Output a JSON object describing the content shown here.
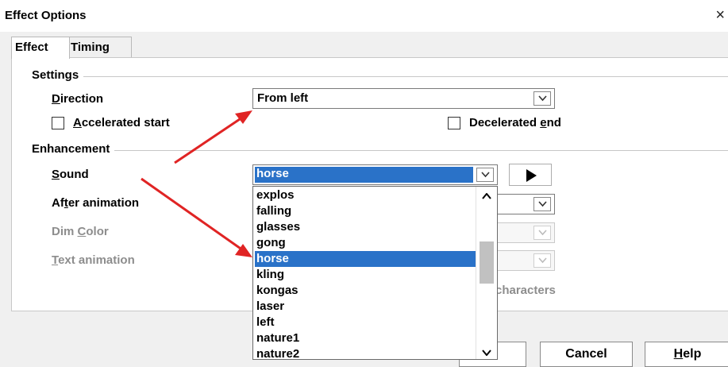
{
  "window": {
    "title": "Effect Options",
    "close_glyph": "×"
  },
  "tabs": [
    {
      "label": "Effect",
      "active": true
    },
    {
      "label": "Timing",
      "active": false
    }
  ],
  "settings": {
    "header": "Settings",
    "direction_label_first": "D",
    "direction_label_rest": "irection",
    "direction_value": "From left",
    "accelerated_label_first": "A",
    "accelerated_label_rest": "ccelerated start",
    "accelerated_checked": false,
    "decelerated_label_pre": "Decelerated ",
    "decelerated_label_u": "e",
    "decelerated_label_post": "nd",
    "decelerated_checked": false
  },
  "enhancement": {
    "header": "Enhancement",
    "sound_label_first": "S",
    "sound_label_rest": "ound",
    "sound_value": "horse",
    "after_animation_label_pre": "Af",
    "after_animation_label_u": "t",
    "after_animation_label_post": "er animation",
    "dim_color_label_pre": "Dim ",
    "dim_color_label_u": "C",
    "dim_color_label_post": "olor",
    "text_animation_label_first": "T",
    "text_animation_label_rest": "ext animation",
    "characters_label": "characters"
  },
  "sound_list": {
    "items": [
      "explos",
      "falling",
      "glasses",
      "gong",
      "horse",
      "kling",
      "kongas",
      "laser",
      "left",
      "nature1",
      "nature2"
    ],
    "selected_index": 4
  },
  "buttons": {
    "cancel": "Cancel",
    "help_first": "H",
    "help_rest": "elp"
  },
  "colors": {
    "selection": "#2a72c8",
    "annotation_arrow": "#e02424"
  },
  "icons": {
    "play": "play-icon",
    "dropdown": "chevron-down-icon",
    "close": "close-icon"
  }
}
